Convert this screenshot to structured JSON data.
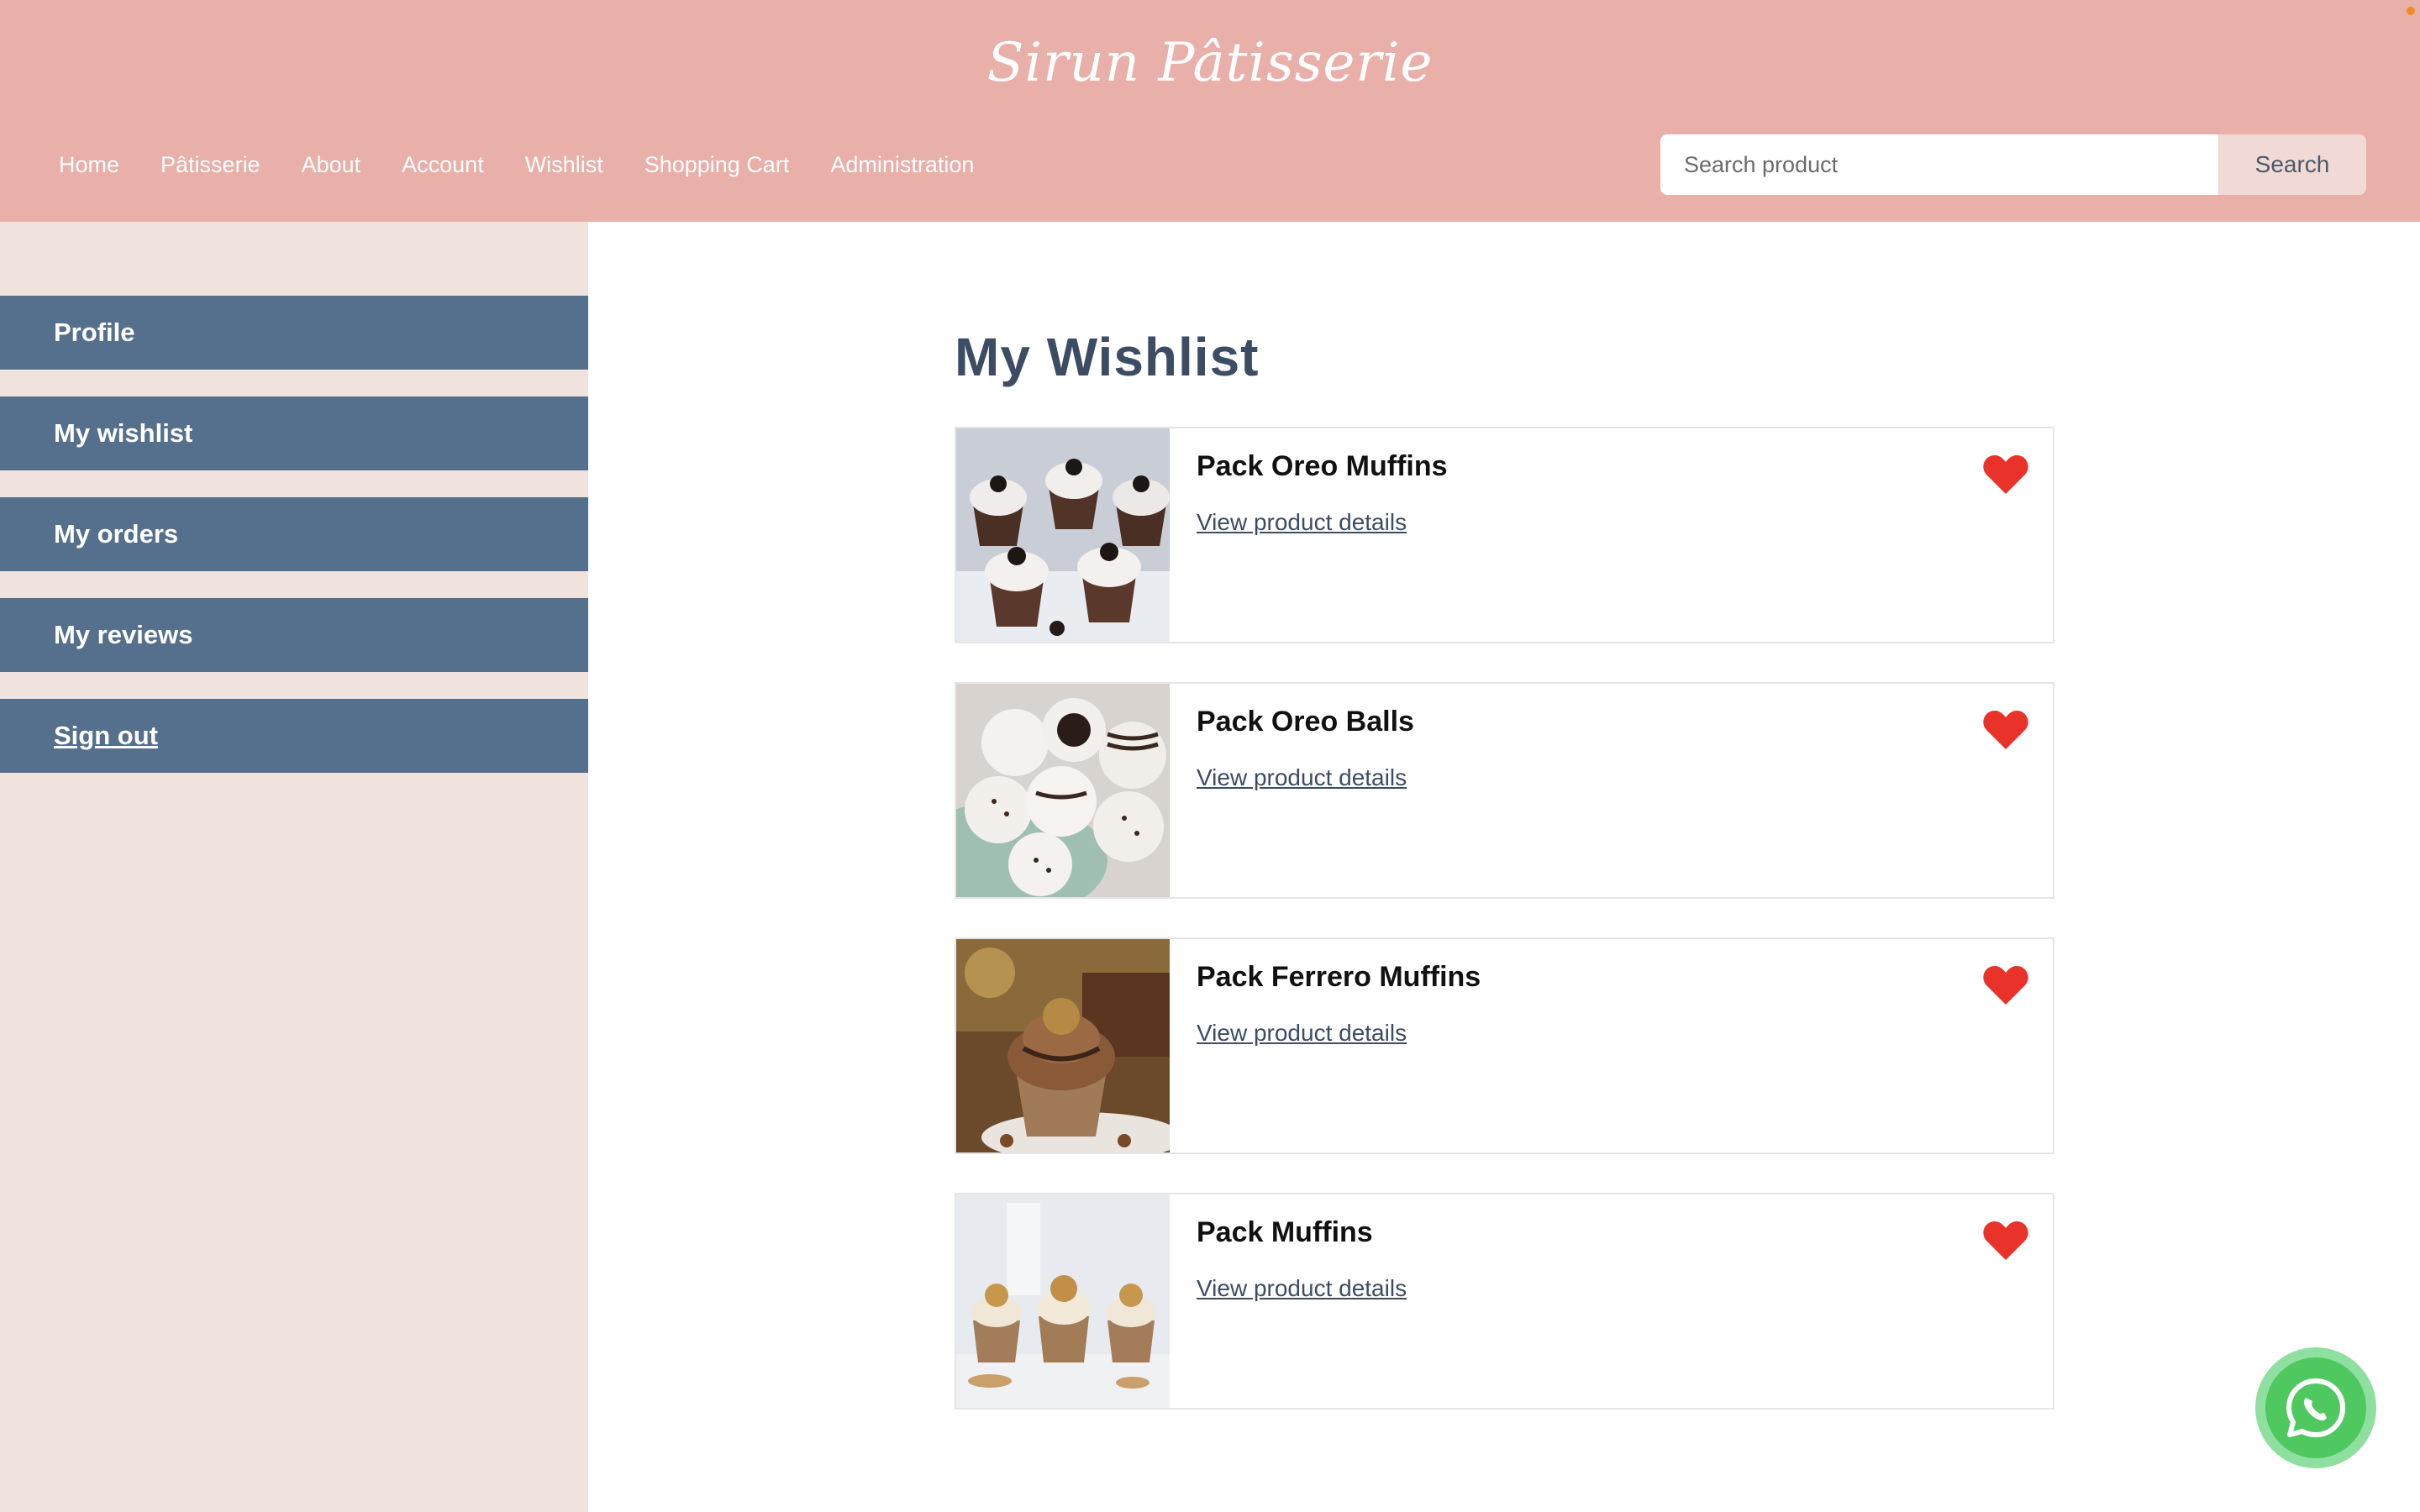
{
  "brand": {
    "name": "Sirun Pâtisserie"
  },
  "nav": {
    "items": [
      "Home",
      "Pâtisserie",
      "About",
      "Account",
      "Wishlist",
      "Shopping Cart",
      "Administration"
    ]
  },
  "search": {
    "placeholder": "Search product",
    "value": "",
    "button_label": "Search"
  },
  "sidebar": {
    "items": [
      {
        "label": "Profile"
      },
      {
        "label": "My wishlist"
      },
      {
        "label": "My orders"
      },
      {
        "label": "My reviews"
      },
      {
        "label": "Sign out"
      }
    ]
  },
  "main": {
    "title": "My Wishlist",
    "items": [
      {
        "name": "Pack Oreo Muffins",
        "link_label": "View product details",
        "image": "oreo-muffins-photo",
        "favorite": true
      },
      {
        "name": "Pack Oreo Balls",
        "link_label": "View product details",
        "image": "oreo-balls-photo",
        "favorite": true
      },
      {
        "name": "Pack Ferrero Muffins",
        "link_label": "View product details",
        "image": "ferrero-muffins-photo",
        "favorite": true
      },
      {
        "name": "Pack Muffins",
        "link_label": "View product details",
        "image": "muffins-photo",
        "favorite": true
      }
    ]
  },
  "icons": {
    "favorite": "heart-icon",
    "chat": "whatsapp-icon"
  },
  "colors": {
    "header_bg": "#e9afa9",
    "sidebar_bg": "#f0e2dd",
    "sidebar_item_bg": "#55708c",
    "title_color": "#3c4d63",
    "heart": "#e8322a",
    "whatsapp": "#4fc95f"
  }
}
